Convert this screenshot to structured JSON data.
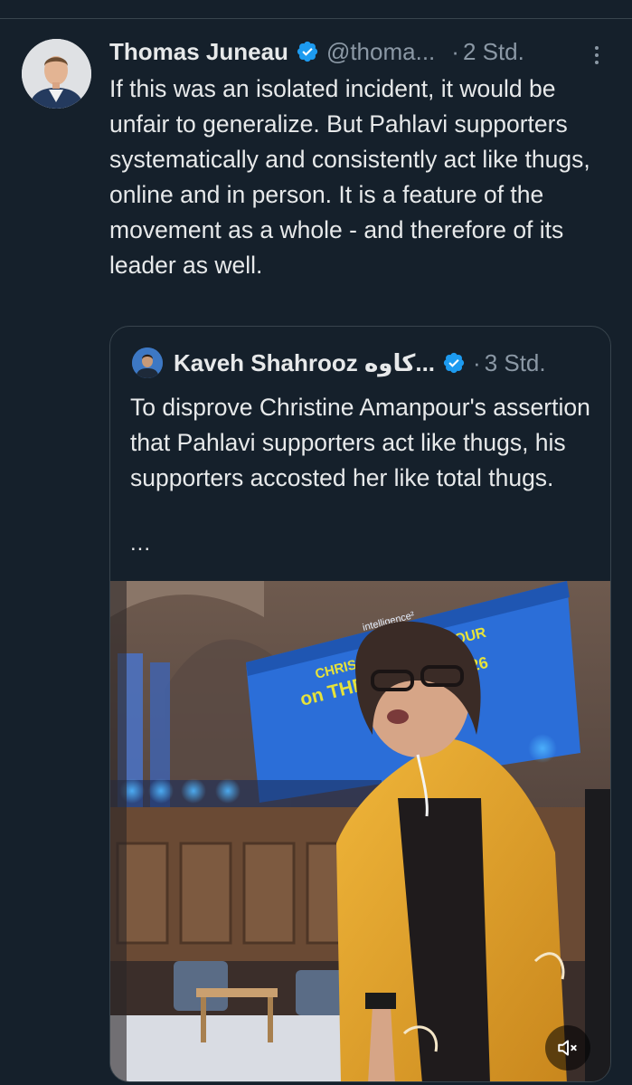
{
  "tweet": {
    "author_name": "Thomas Juneau",
    "handle": "@thoma...",
    "separator": "·",
    "time": "2 Std.",
    "text": "If this was an isolated incident, it would be unfair to generalize. But Pahlavi supporters systematically and consistently act like thugs, online and in person. It is a feature of the movement as a whole - and therefore of its leader as well."
  },
  "quote": {
    "author_name": "Kaveh Shahrooz كاوه...",
    "separator": "·",
    "time": "3 Std.",
    "text": "To disprove Christine Amanpour's assertion that Pahlavi supporters act like thugs, his supporters accosted her like total thugs.",
    "ellipsis": "...",
    "video": {
      "screen_brand": "intelligence²",
      "screen_title_left": "CHRIS",
      "screen_title_right": "OUR",
      "screen_line2": "on THE W",
      "screen_year": "2026",
      "mute_icon": "speaker-muted-icon"
    }
  },
  "colors": {
    "background": "#15202b",
    "border": "#38444d",
    "text_primary": "#e7e9ea",
    "text_secondary": "#8b98a5",
    "verified_blue": "#1d9bf0",
    "screen_blue": "#2b6ed8",
    "screen_yellow": "#e6e23a",
    "jacket_yellow": "#e0a02a"
  }
}
